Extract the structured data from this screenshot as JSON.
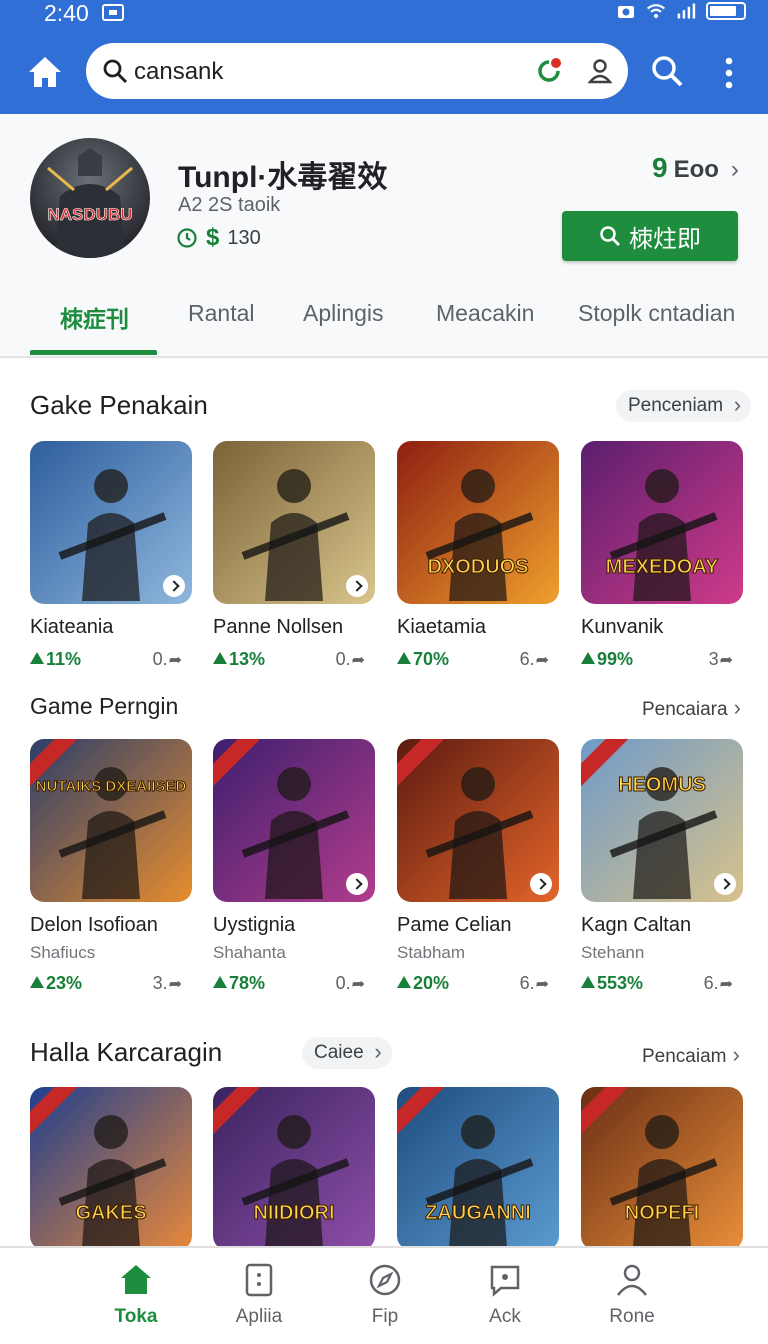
{
  "status_bar": {
    "time": "2:40"
  },
  "search": {
    "query": "cansank"
  },
  "profile": {
    "name": "Tunpl·水毒翟效",
    "subtitle": "A2 2S taoik",
    "price": "130",
    "price_symbol": "$",
    "rating_num": "9",
    "rating_text": "Eoo",
    "install_label": "栜炷即",
    "avatar_text": "NASDUBU"
  },
  "tabs": [
    "栜症刊",
    "Rantal",
    "Aplingis",
    "Meacakin",
    "Stoplk cntadian"
  ],
  "sections": [
    {
      "title": "Gake Penakain",
      "pill": "Penceniam",
      "cards": [
        {
          "title": "Kiateania",
          "percent": "11%",
          "count": "0.",
          "colors": [
            "#2e5e9e",
            "#8fb7dd"
          ]
        },
        {
          "title": "Panne Nollsen",
          "percent": "13%",
          "count": "0.",
          "colors": [
            "#7a6338",
            "#d9c58c"
          ]
        },
        {
          "title": "Kiaetamia",
          "percent": "70%",
          "count": "6.",
          "colors": [
            "#8e1f12",
            "#f0a02d"
          ],
          "art_text": "DXODUOS"
        },
        {
          "title": "Kunvanik",
          "percent": "99%",
          "count": "3",
          "colors": [
            "#5a1f6e",
            "#d03a8a"
          ],
          "art_text": "MEXEDOAY"
        }
      ]
    },
    {
      "title": "Game Perngin",
      "link": "Pencaiara",
      "cards": [
        {
          "title": "Delon Isofioan",
          "subtitle": "Shafiucs",
          "percent": "23%",
          "count": "3.",
          "colors": [
            "#2b3e6b",
            "#e88d2e"
          ],
          "art_text": "NUTAIKS DXEAIISED"
        },
        {
          "title": "Uystignia",
          "subtitle": "Shahanta",
          "percent": "78%",
          "count": "0.",
          "colors": [
            "#3d1f6e",
            "#b33c8c"
          ]
        },
        {
          "title": "Pame Celian",
          "subtitle": "Stabham",
          "percent": "20%",
          "count": "6.",
          "colors": [
            "#5c1a10",
            "#e4652a"
          ]
        },
        {
          "title": "Kagn Caltan",
          "subtitle": "Stehann",
          "percent": "553%",
          "count": "6.",
          "colors": [
            "#6e9ac9",
            "#d8c28a"
          ],
          "art_text": "HEOMUS"
        }
      ]
    },
    {
      "title": "Halla Karcaragin",
      "pill": "Caiee",
      "link": "Pencaiam",
      "cards": [
        {
          "title": "",
          "colors": [
            "#1f3f8f",
            "#e8883a"
          ],
          "art_text": "GAKES"
        },
        {
          "title": "",
          "colors": [
            "#3b2460",
            "#8e4ea8"
          ],
          "art_text": "NIIDIORI"
        },
        {
          "title": "",
          "colors": [
            "#1f4c7e",
            "#5b9bd0"
          ],
          "art_text": "ZAUGANNI"
        },
        {
          "title": "",
          "colors": [
            "#6b2e14",
            "#e98f3a"
          ],
          "art_text": "NOPEFI"
        }
      ]
    }
  ],
  "bottom_nav": [
    "Toka",
    "Apliia",
    "Fip",
    "Ack",
    "Rone"
  ],
  "colors": {
    "appbar": "#2f6fd6",
    "accent_green": "#1e8e3e"
  }
}
